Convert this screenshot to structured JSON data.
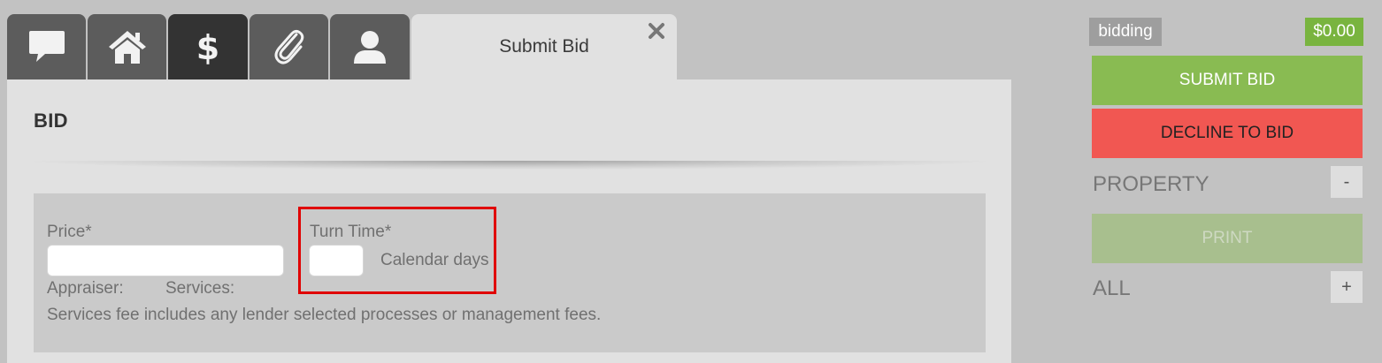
{
  "tabs": {
    "icons": [
      "chat-icon",
      "home-icon",
      "dollar-icon",
      "paperclip-icon",
      "user-icon"
    ],
    "active_title": "Submit Bid",
    "close_icon": "close-icon"
  },
  "bid": {
    "section_title": "BID",
    "price_label": "Price*",
    "price_value": "",
    "turn_time_label": "Turn Time*",
    "turn_time_value": "",
    "turn_time_unit": "Calendar days",
    "appraiser_label": "Appraiser:",
    "services_label": "Services:",
    "fee_note": "Services fee includes any lender selected processes or management fees."
  },
  "sidebar": {
    "status": "bidding",
    "amount": "$0.00",
    "submit_label": "SUBMIT BID",
    "decline_label": "DECLINE TO BID",
    "property_heading": "PROPERTY",
    "property_toggle": "-",
    "print_label": "PRINT",
    "all_heading": "ALL",
    "all_toggle": "+"
  },
  "colors": {
    "accent_green": "#89bb52",
    "decline_red": "#f15752",
    "highlight_red": "#e00000",
    "amount_green": "#79b43f"
  }
}
